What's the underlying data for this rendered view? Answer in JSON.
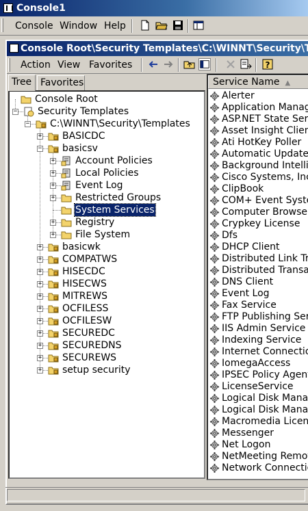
{
  "window": {
    "title": "Console1"
  },
  "menubar": {
    "items": [
      "Console",
      "Window",
      "Help"
    ]
  },
  "child_window": {
    "title": "Console Root\\Security Templates\\C:\\WINNT\\Security\\Templates"
  },
  "action_bar": {
    "items": [
      "Action",
      "View",
      "Favorites"
    ]
  },
  "tabs": [
    "Tree",
    "Favorites"
  ],
  "tree": [
    {
      "label": "Console Root",
      "level": 0,
      "icon": "folder-icon"
    },
    {
      "label": "Security Templates",
      "level": 1,
      "icon": "security-templates-icon",
      "expanded": true
    },
    {
      "label": "C:\\WINNT\\Security\\Templates",
      "level": 2,
      "icon": "template-folder-icon",
      "expanded": true
    },
    {
      "label": "BASICDC",
      "level": 3,
      "icon": "template-icon",
      "expanded": false
    },
    {
      "label": "basicsv",
      "level": 3,
      "icon": "template-icon",
      "expanded": true
    },
    {
      "label": "Account Policies",
      "level": 4,
      "icon": "policy-icon",
      "expanded": false
    },
    {
      "label": "Local Policies",
      "level": 4,
      "icon": "policy-icon",
      "expanded": false
    },
    {
      "label": "Event Log",
      "level": 4,
      "icon": "policy-icon",
      "expanded": false
    },
    {
      "label": "Restricted Groups",
      "level": 4,
      "icon": "folder-icon",
      "expanded": false
    },
    {
      "label": "System Services",
      "level": 4,
      "icon": "folder-icon",
      "selected": true
    },
    {
      "label": "Registry",
      "level": 4,
      "icon": "folder-icon",
      "expanded": false
    },
    {
      "label": "File System",
      "level": 4,
      "icon": "folder-icon",
      "expanded": false
    },
    {
      "label": "basicwk",
      "level": 3,
      "icon": "template-icon",
      "expanded": false
    },
    {
      "label": "COMPATWS",
      "level": 3,
      "icon": "template-icon",
      "expanded": false
    },
    {
      "label": "HISECDC",
      "level": 3,
      "icon": "template-icon",
      "expanded": false
    },
    {
      "label": "HISECWS",
      "level": 3,
      "icon": "template-icon",
      "expanded": false
    },
    {
      "label": "MITREWS",
      "level": 3,
      "icon": "template-icon",
      "expanded": false
    },
    {
      "label": "OCFILESS",
      "level": 3,
      "icon": "template-icon",
      "expanded": false
    },
    {
      "label": "OCFILESW",
      "level": 3,
      "icon": "template-icon",
      "expanded": false
    },
    {
      "label": "SECUREDC",
      "level": 3,
      "icon": "template-icon",
      "expanded": false
    },
    {
      "label": "SECUREDNS",
      "level": 3,
      "icon": "template-icon",
      "expanded": false
    },
    {
      "label": "SECUREWS",
      "level": 3,
      "icon": "template-icon",
      "expanded": false
    },
    {
      "label": "setup security",
      "level": 3,
      "icon": "template-icon",
      "expanded": false
    }
  ],
  "list": {
    "column_header": "Service Name",
    "items": [
      "Alerter",
      "Application Manager",
      "ASP.NET State Serv",
      "Asset Insight Client",
      "Ati HotKey Poller",
      "Automatic Updates",
      "Background Intellige",
      "Cisco Systems, Inc. V",
      "ClipBook",
      "COM+ Event System",
      "Computer Browser",
      "Crypkey License",
      "Dfs",
      "DHCP Client",
      "Distributed Link Trac",
      "Distributed Transact",
      "DNS Client",
      "Event Log",
      "Fax Service",
      "FTP Publishing Serv",
      "IIS Admin Service",
      "Indexing Service",
      "Internet Connection",
      "IomegaAccess",
      "IPSEC Policy Agent",
      "LicenseService",
      "Logical Disk Manage",
      "Logical Disk Manage",
      "Macromedia Licensin",
      "Messenger",
      "Net Logon",
      "NetMeeting Remote",
      "Network Connections"
    ]
  },
  "colors": {
    "title_active": "#0a246a",
    "selection": "#0a246a",
    "chrome": "#d4d0c8"
  }
}
